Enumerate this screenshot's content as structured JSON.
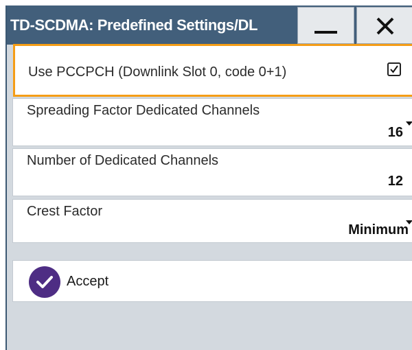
{
  "window": {
    "title": "TD-SCDMA: Predefined Settings/DL",
    "minimize_icon": "minimize-icon",
    "close_icon": "close-icon"
  },
  "settings": {
    "use_pccpch": {
      "label": "Use PCCPCH (Downlink Slot 0, code 0+1)",
      "checked": true
    },
    "spreading_factor": {
      "label": "Spreading Factor Dedicated Channels",
      "value": "16"
    },
    "num_dedicated_channels": {
      "label": "Number of Dedicated Channels",
      "value": "12"
    },
    "crest_factor": {
      "label": "Crest Factor",
      "value": "Minimum"
    }
  },
  "actions": {
    "accept_label": "Accept",
    "accept_icon": "checkmark-circle-icon"
  },
  "colors": {
    "titlebar": "#425f7b",
    "focus_border": "#f59d16",
    "dialog_bg": "#d3d9df",
    "accept_icon_bg": "#4e2d84"
  }
}
